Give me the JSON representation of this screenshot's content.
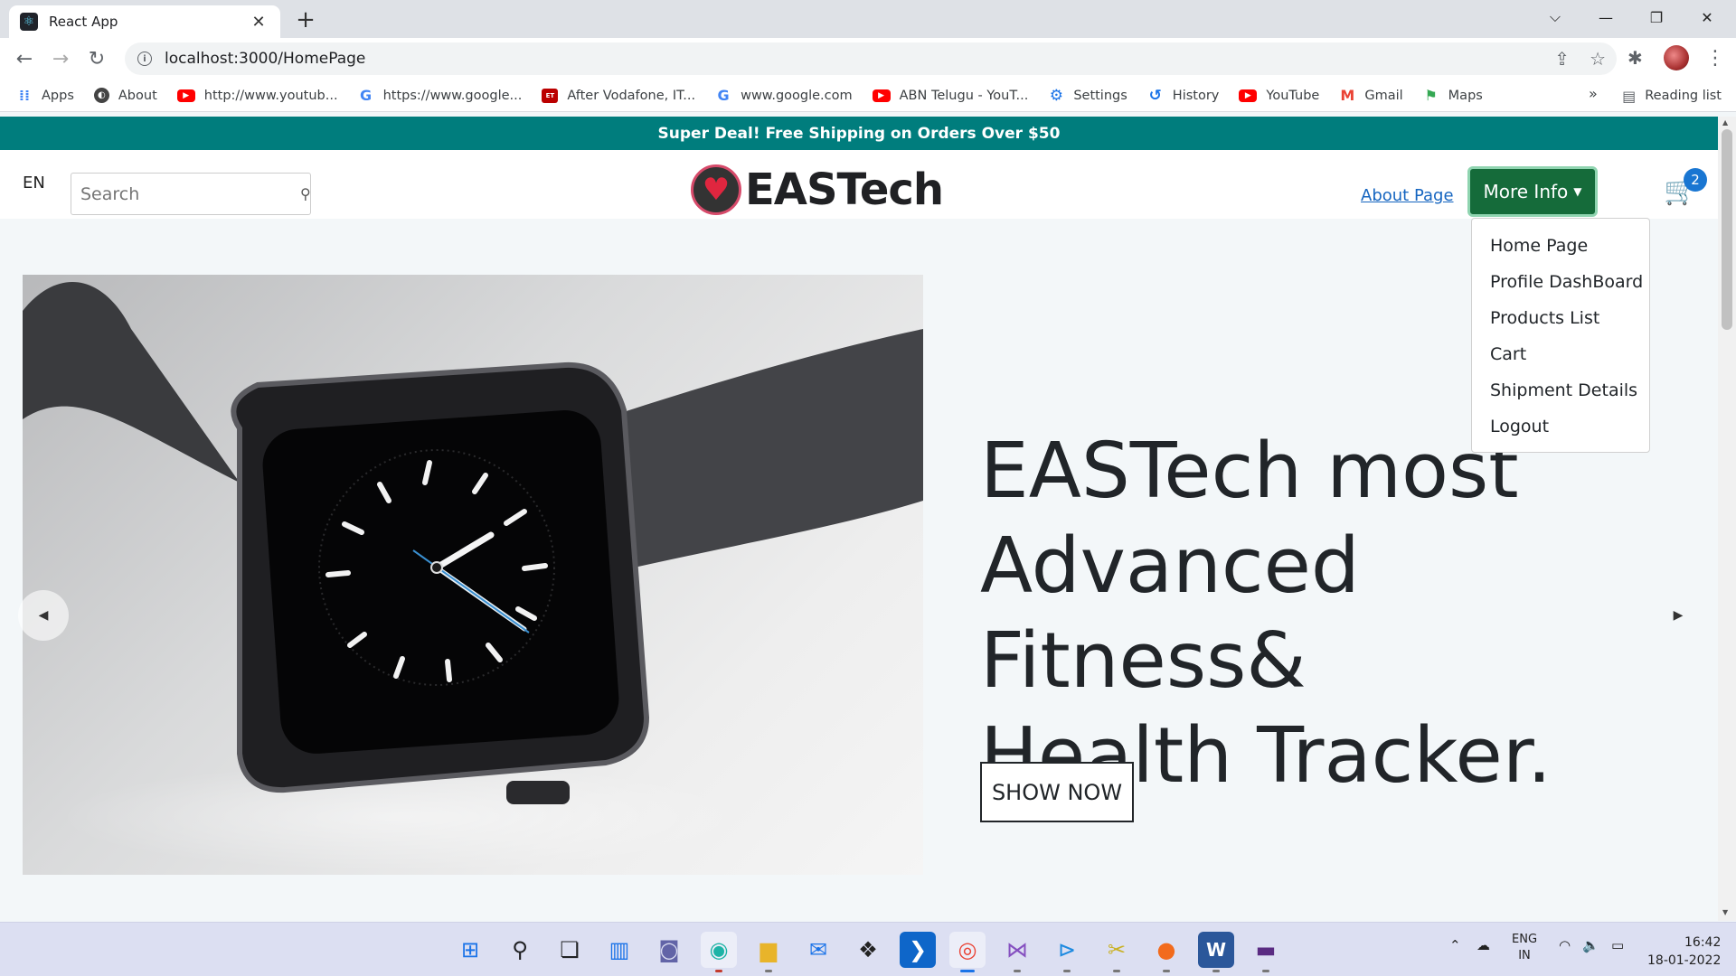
{
  "browser": {
    "tab_title": "React App",
    "tab_close": "✕",
    "new_tab": "+",
    "url": "localhost:3000/HomePage",
    "window_controls": {
      "dropdown": "⌵",
      "minimize": "—",
      "restore": "❐",
      "close": "✕"
    },
    "bookmarks": [
      {
        "icon": "apps-icon",
        "label": "Apps"
      },
      {
        "icon": "globe-icon",
        "label": "About"
      },
      {
        "icon": "youtube-icon",
        "label": "http://www.youtub..."
      },
      {
        "icon": "google-icon",
        "label": "https://www.google..."
      },
      {
        "icon": "news-icon",
        "label": "After Vodafone, IT..."
      },
      {
        "icon": "google-icon",
        "label": "www.google.com"
      },
      {
        "icon": "youtube-icon",
        "label": "ABN Telugu - YouT..."
      },
      {
        "icon": "gear-icon",
        "label": "Settings"
      },
      {
        "icon": "history-icon",
        "label": "History"
      },
      {
        "icon": "youtube-icon",
        "label": "YouTube"
      },
      {
        "icon": "gmail-icon",
        "label": "Gmail"
      },
      {
        "icon": "maps-icon",
        "label": "Maps"
      }
    ],
    "bookmarks_more": "»",
    "reading_list": "Reading list"
  },
  "site": {
    "promo_banner": "Super Deal! Free Shipping on Orders Over $50",
    "language": "EN",
    "search_placeholder": "Search",
    "logo_text": "EASTech",
    "about_link": "About Page",
    "more_info": "More Info",
    "cart_count": "2",
    "dropdown_items": [
      "Home Page",
      "Profile DashBoard",
      "Products List",
      "Cart",
      "Shipment Details",
      "Logout"
    ],
    "hero": {
      "line1": "EASTech most",
      "line2": "Advanced Fitness&",
      "line3": "Health Tracker.",
      "button": "SHOW NOW"
    }
  },
  "taskbar": {
    "language_line1": "ENG",
    "language_line2": "IN",
    "time": "16:42",
    "date": "18-01-2022"
  },
  "colors": {
    "promo_bg": "#007d7d",
    "more_info_bg": "#156b3a",
    "link": "#1565c0",
    "cart": "#1976d2"
  }
}
